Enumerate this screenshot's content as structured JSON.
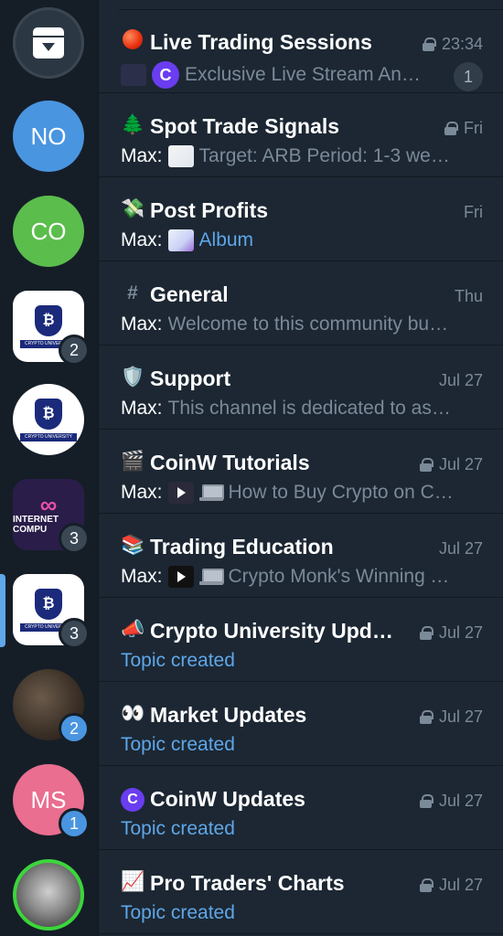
{
  "sidebar": {
    "items": [
      {
        "name": "archive",
        "icon": "archive-icon"
      },
      {
        "initials": "NO"
      },
      {
        "initials": "CO"
      },
      {
        "badge": "2",
        "logo_text": "CRYPTO UNIVERSITY"
      },
      {
        "logo_text": "CRYPTO UNIVERSITY"
      },
      {
        "badge": "3",
        "logo_text": "INTERNET COMPU"
      },
      {
        "badge": "3",
        "logo_text": "CRYPTO UNIVERSITY"
      },
      {
        "badge": "2"
      },
      {
        "initials": "MS",
        "badge": "1"
      },
      {}
    ]
  },
  "topics": [
    {
      "emoji": "red-circle-icon",
      "title": "Live Trading Sessions",
      "time": "23:34",
      "locked": true,
      "preview": "Exclusive Live Stream An…",
      "unread": "1"
    },
    {
      "emoji": "🌲",
      "title": "Spot Trade Signals",
      "time": "Fri",
      "locked": true,
      "sender": "Max:",
      "preview": "Target: ARB Period: 1-3 wee…"
    },
    {
      "emoji": "💸",
      "title": "Post Profits",
      "time": "Fri",
      "locked": false,
      "sender": "Max:",
      "preview": "Album"
    },
    {
      "emoji": "#",
      "title": "General",
      "time": "Thu",
      "locked": false,
      "sender": "Max:",
      "preview": "Welcome to this community bu…"
    },
    {
      "emoji": "🛡️",
      "title": "Support",
      "time": "Jul 27",
      "locked": false,
      "sender": "Max:",
      "preview": "This channel is dedicated to as…"
    },
    {
      "emoji": "🎬",
      "title": "CoinW Tutorials",
      "time": "Jul 27",
      "locked": true,
      "sender": "Max:",
      "preview": "How to Buy Crypto on Co…"
    },
    {
      "emoji": "📚",
      "title": "Trading Education",
      "time": "Jul 27",
      "locked": false,
      "sender": "Max:",
      "preview": "Crypto Monk's Winning T…"
    },
    {
      "emoji": "📣",
      "title": "Crypto University Upd…",
      "time": "Jul 27",
      "locked": true,
      "preview": "Topic created"
    },
    {
      "emoji": "👀",
      "title": "Market Updates",
      "time": "Jul 27",
      "locked": true,
      "preview": "Topic created"
    },
    {
      "emoji": "coinw-icon",
      "title": "CoinW Updates",
      "time": "Jul 27",
      "locked": true,
      "preview": "Topic created"
    },
    {
      "emoji": "📈",
      "title": "Pro Traders' Charts",
      "time": "Jul 27",
      "locked": true,
      "preview": "Topic created"
    }
  ]
}
